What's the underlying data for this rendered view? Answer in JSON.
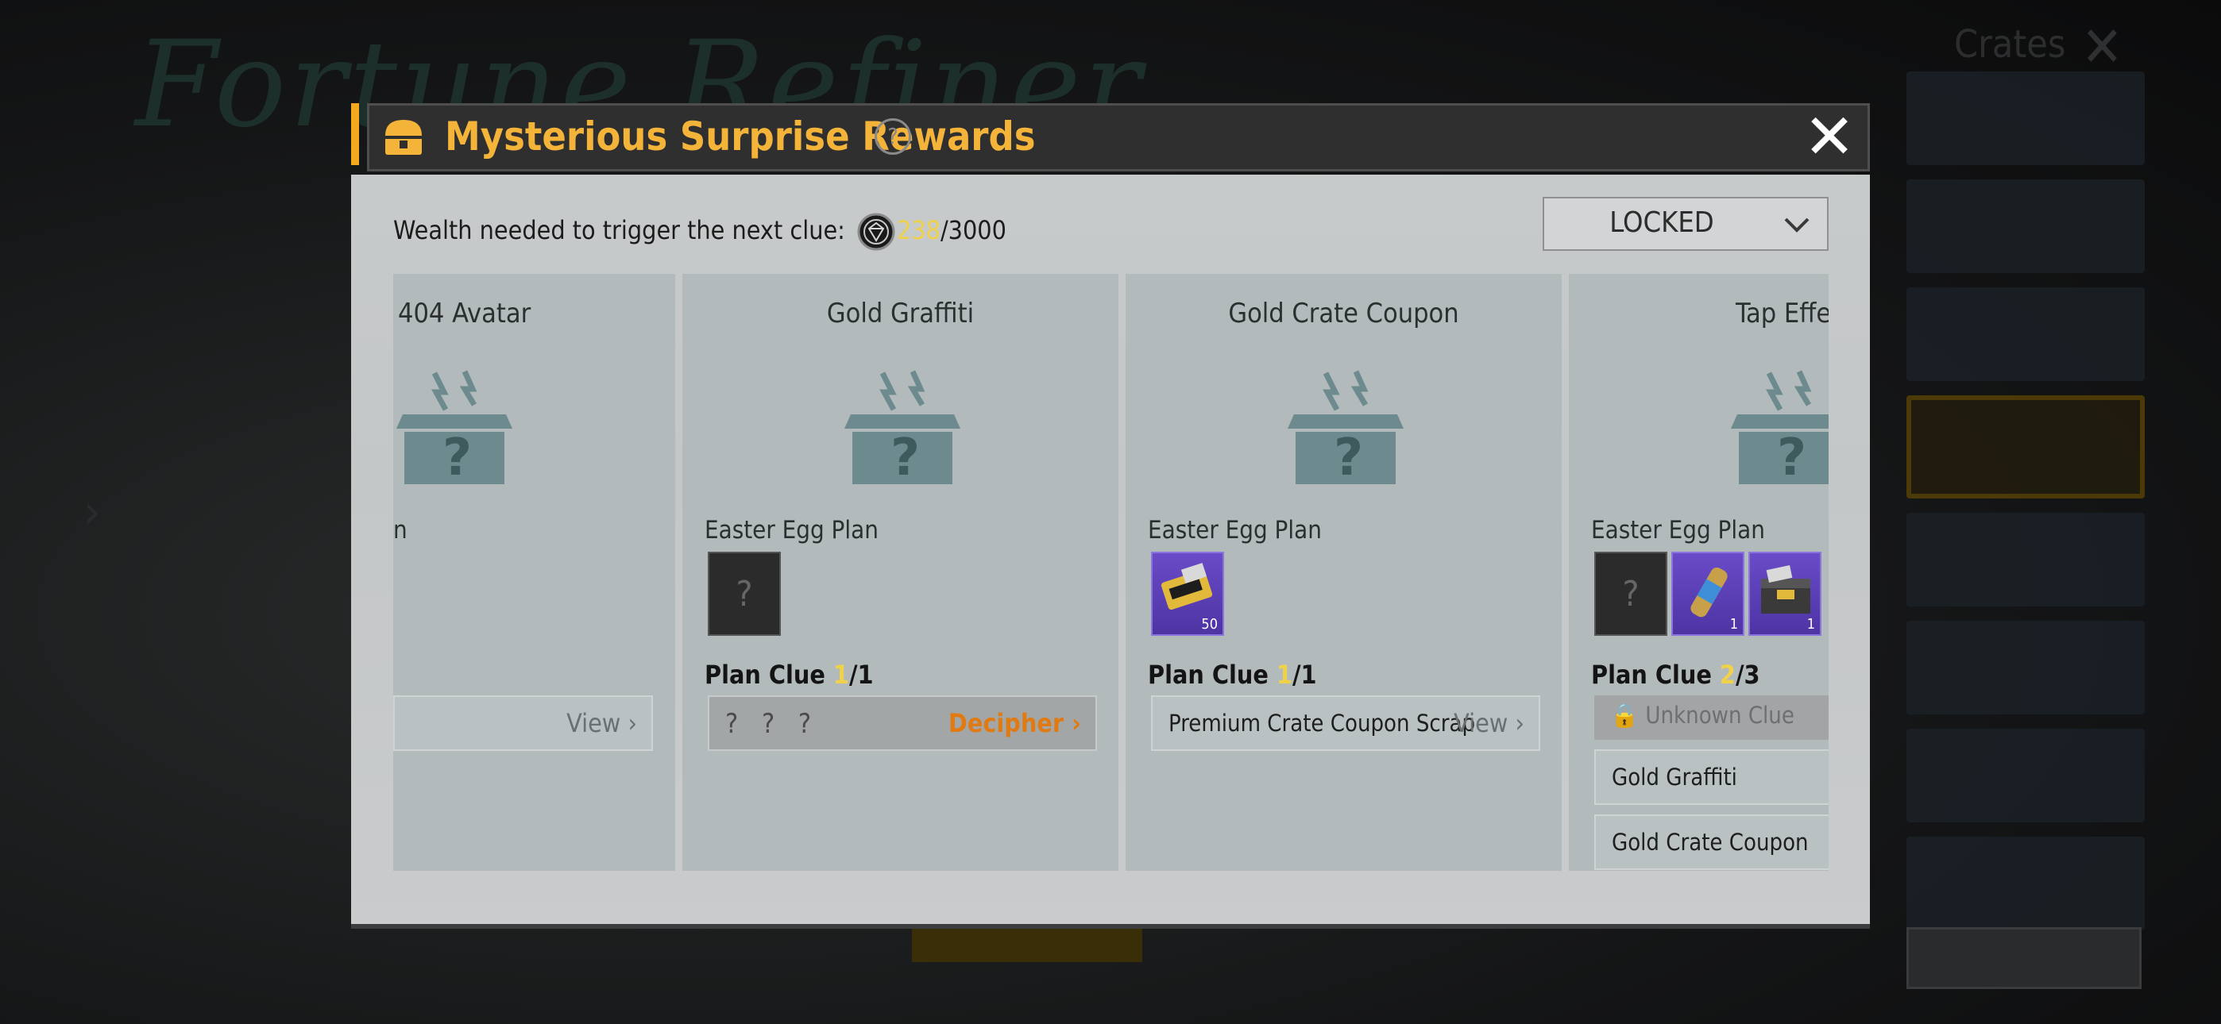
{
  "dialog": {
    "title": "Mysterious Surprise Rewards",
    "help_symbol": "?",
    "close_symbol": "✕"
  },
  "wealth": {
    "label": "Wealth needed to trigger the next clue:",
    "current": "238",
    "max": "/3000"
  },
  "filter": {
    "selected": "LOCKED"
  },
  "cards": [
    {
      "title": "404 Avatar",
      "egg_label": "n",
      "rows": [
        {
          "text": "",
          "action": "View"
        }
      ]
    },
    {
      "title": "Gold Graffiti",
      "egg_label": "Easter Egg Plan",
      "slots": [
        {
          "type": "unknown",
          "symbol": "?"
        }
      ],
      "plan_label": "Plan Clue ",
      "plan_current": "1",
      "plan_total": "/1",
      "rows": [
        {
          "text": "? ? ?",
          "action": "Decipher"
        }
      ]
    },
    {
      "title": "Gold Crate Coupon",
      "egg_label": "Easter Egg Plan",
      "slots": [
        {
          "type": "item",
          "icon": "crate-coupon-icon",
          "qty": "50"
        }
      ],
      "plan_label": "Plan Clue ",
      "plan_current": "1",
      "plan_total": "/1",
      "rows": [
        {
          "text": "Premium Crate Coupon Scrap",
          "action": "View"
        }
      ]
    },
    {
      "title": "Tap Effec",
      "egg_label": "Easter Egg Plan",
      "slots": [
        {
          "type": "unknown",
          "symbol": "?"
        },
        {
          "type": "item",
          "icon": "grenade-skin-icon",
          "qty": "1"
        },
        {
          "type": "item",
          "icon": "crate-icon",
          "qty": "1"
        }
      ],
      "plan_label": "Plan Clue ",
      "plan_current": "2",
      "plan_total": "/3",
      "rows": [
        {
          "text": "Unknown Clue",
          "locked": true
        },
        {
          "text": "Gold Graffiti"
        },
        {
          "text": "Gold Crate Coupon"
        }
      ]
    }
  ],
  "background": {
    "title": "Fortune Refiner",
    "sidebar_title": "Crates"
  },
  "colors": {
    "accent": "#f5a91c",
    "title": "#f4b43a",
    "highlight": "#f0d24a",
    "decipher": "#e07a12"
  }
}
